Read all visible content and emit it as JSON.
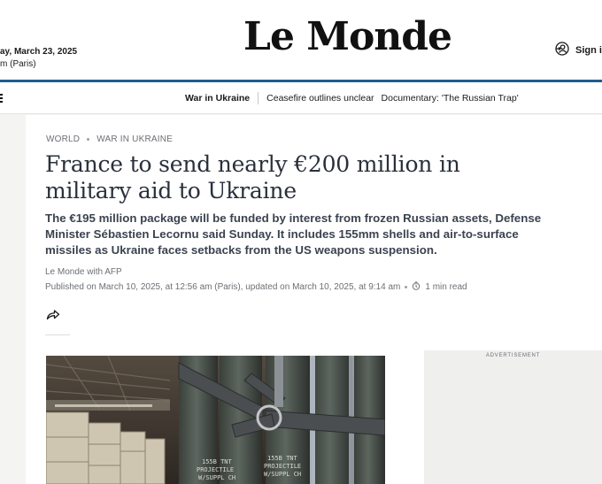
{
  "masthead": {
    "date": "ay, March 23, 2025",
    "edition": "m (Paris)",
    "logo_text": "Le Monde",
    "signin_label": "Sign in"
  },
  "nav": {
    "items": [
      {
        "label": "War in Ukraine"
      },
      {
        "label": "Ceasefire outlines unclear"
      },
      {
        "label": "Documentary: 'The Russian Trap'"
      }
    ]
  },
  "article": {
    "breadcrumb": [
      "WORLD",
      "WAR IN UKRAINE"
    ],
    "headline": "France to send nearly €200 million in military aid to Ukraine",
    "standfirst": "The €195 million package will be funded by interest from frozen Russian assets, Defense Minister Sébastien Lecornu said Sunday. It includes 155mm shells and air-to-surface missiles as Ukraine faces setbacks from the US weapons suspension.",
    "byline": "Le Monde with AFP",
    "published": "Published on March 10, 2025, at 12:56 am (Paris), updated on March 10, 2025, at 9:14 am",
    "read_time": "1 min read"
  },
  "photo": {
    "shell_markings": [
      "155B TNT",
      "PROJECTILE",
      "W/SUPPL CH"
    ]
  },
  "ad": {
    "label": "ADVERTISEMENT"
  },
  "colors": {
    "accent_rule": "#1f5d8d",
    "headline": "#2a303b",
    "meta": "#6b6f75"
  },
  "icons": [
    "menu-icon",
    "user-signin-icon",
    "share-icon",
    "clock-icon"
  ]
}
